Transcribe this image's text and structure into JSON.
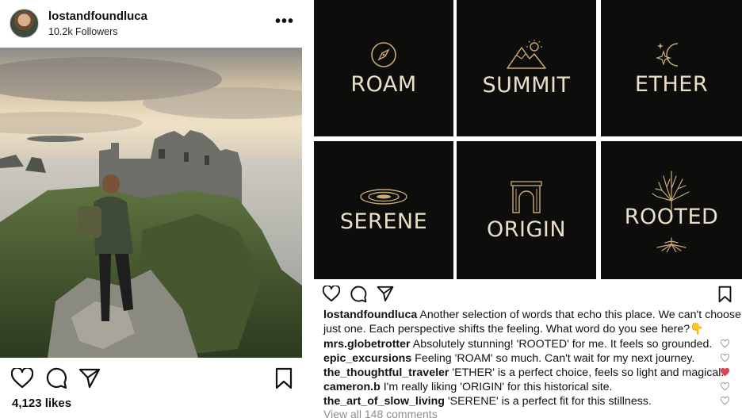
{
  "left_post": {
    "username": "lostandfoundluca",
    "followers": "10.2k Followers",
    "more_icon": "more-horizontal-icon",
    "likes": "4,123 likes",
    "actions": [
      "heart-icon",
      "comment-icon",
      "share-icon",
      "bookmark-icon"
    ]
  },
  "right_post": {
    "tiles": [
      {
        "word": "ROAM",
        "icon": "compass-icon"
      },
      {
        "word": "SUMMIT",
        "icon": "mountain-sun-icon"
      },
      {
        "word": "ETHER",
        "icon": "moon-stars-icon"
      },
      {
        "word": "SERENE",
        "icon": "ripple-icon"
      },
      {
        "word": "ORIGIN",
        "icon": "archway-icon"
      },
      {
        "word": "ROOTED",
        "icon": "tree-roots-icon"
      }
    ],
    "caption": {
      "username": "lostandfoundluca",
      "text": "Another selection of words that echo this place. We can't choose just one. Each perspective shifts the feeling. What word do you see here?",
      "emoji": "👇"
    },
    "comments": [
      {
        "user": "mrs.globetrotter",
        "text": "Absolutely stunning! 'ROOTED' for me. It feels so grounded.",
        "liked": false
      },
      {
        "user": "epic_excursions",
        "text": "Feeling 'ROAM' so much. Can't wait for my next journey.",
        "liked": false
      },
      {
        "user": "the_thoughtful_traveler",
        "text": "'ETHER' is a perfect choice, feels so light and magical.",
        "liked": true
      },
      {
        "user": "cameron.b",
        "text": "I'm really liking 'ORIGIN' for this historical site.",
        "liked": false
      },
      {
        "user": "the_art_of_slow_living",
        "text": "'SERENE' is a perfect fit for this stillness.",
        "liked": false
      }
    ],
    "view_all": "View all 148 comments"
  },
  "colors": {
    "tile_bg": "#0d0d0b",
    "tile_text": "#eadfc8",
    "gold": "#c9a978",
    "like_red": "#e0454f"
  }
}
